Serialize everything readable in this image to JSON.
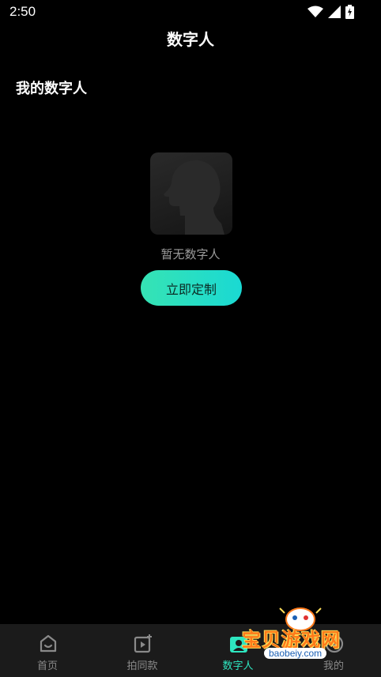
{
  "status_bar": {
    "time": "2:50",
    "icons": [
      "wifi-icon",
      "signal-icon",
      "battery-charging-icon"
    ]
  },
  "header": {
    "title": "数字人"
  },
  "section": {
    "title": "我的数字人"
  },
  "empty_state": {
    "icon": "head-silhouette-icon",
    "text": "暂无数字人",
    "button_label": "立即定制"
  },
  "bottom_nav": {
    "items": [
      {
        "label": "首页",
        "icon": "home-icon",
        "active": false
      },
      {
        "label": "拍同款",
        "icon": "video-add-icon",
        "active": false
      },
      {
        "label": "数字人",
        "icon": "digital-human-icon",
        "active": true
      },
      {
        "label": "我的",
        "icon": "profile-icon",
        "active": false
      }
    ]
  },
  "watermark": {
    "text": "宝贝游戏网",
    "url": "baobeiy.com"
  },
  "colors": {
    "accent": "#2ee6c0",
    "button_gradient_start": "#36e3b4",
    "button_gradient_end": "#1ad9d3",
    "nav_bg": "#1b1b1b"
  }
}
